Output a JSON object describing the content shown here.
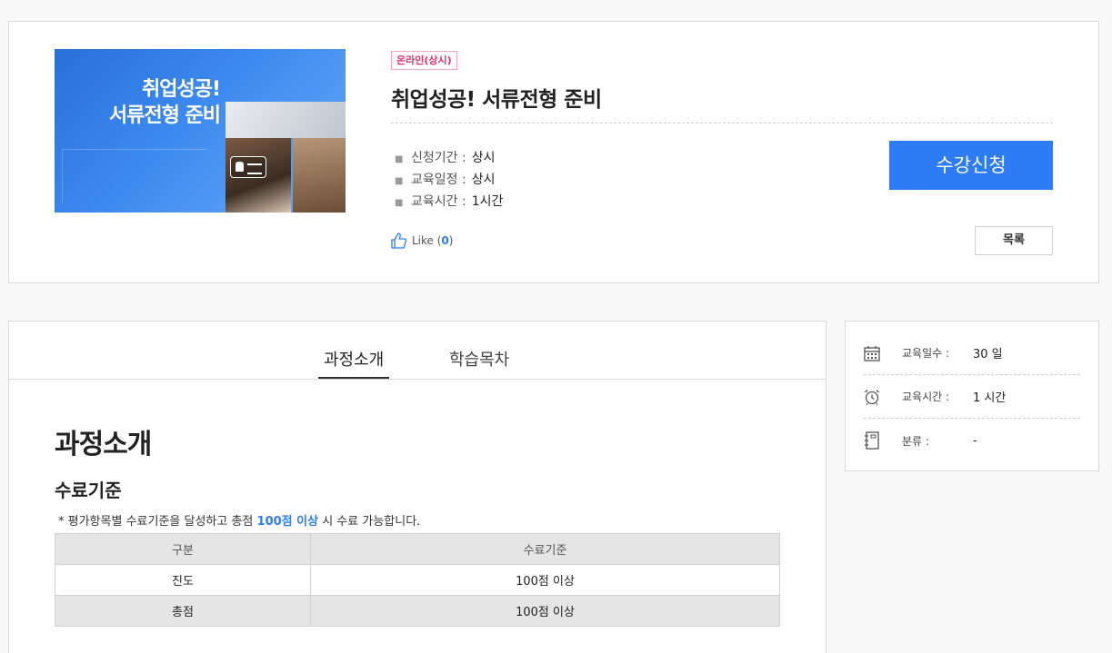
{
  "course": {
    "thumbnail_title": "취업성공!\n서류전형 준비",
    "badge": "온라인(상시)",
    "title": "취업성공! 서류전형 준비",
    "info": [
      {
        "label": "신청기간 :",
        "value": "상시"
      },
      {
        "label": "교육일정 :",
        "value": "상시"
      },
      {
        "label": "교육시간 :",
        "value": "1시간"
      }
    ],
    "apply_label": "수강신청",
    "like_text": "Like (",
    "like_count": "0",
    "like_close": ")",
    "list_label": "목록"
  },
  "tabs": [
    {
      "label": "과정소개",
      "active": true
    },
    {
      "label": "학습목차",
      "active": false
    }
  ],
  "content": {
    "heading": "과정소개",
    "subheading": "수료기준",
    "note_prefix": "* 평가항목별 수료기준을 달성하고 총점 ",
    "note_highlight": "100점 이상",
    "note_suffix": " 시 수료 가능합니다.",
    "table": {
      "headers": [
        "구분",
        "수료기준"
      ],
      "rows": [
        [
          "진도",
          "100점 이상"
        ],
        [
          "총점",
          "100점 이상"
        ]
      ]
    }
  },
  "sidebar": {
    "rows": [
      {
        "icon": "calendar-icon",
        "label": "교육일수 :",
        "value": "30 일"
      },
      {
        "icon": "alarm-clock-icon",
        "label": "교육시간 :",
        "value": "1 시간"
      },
      {
        "icon": "notebook-icon",
        "label": "분류 :",
        "value": "-"
      }
    ]
  },
  "colors": {
    "accent": "#2d7cf6",
    "badge": "#e3306a"
  }
}
